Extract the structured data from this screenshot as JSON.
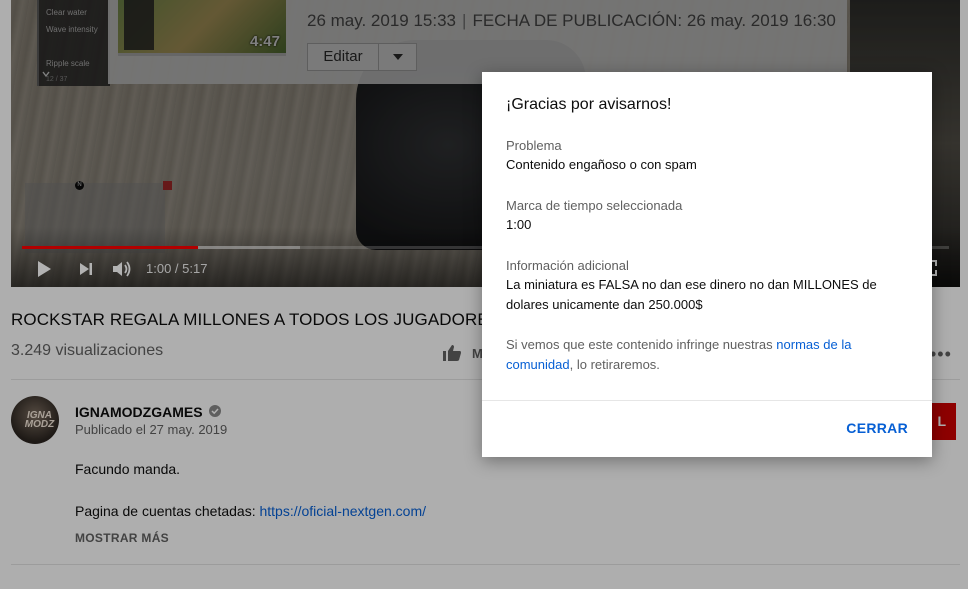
{
  "video": {
    "overlay_menu": [
      "Clear water",
      "Wave intensity",
      "Ripple scale"
    ],
    "overlay_counter": "12 / 37",
    "studio": {
      "thumb_duration": "4:47",
      "date_created": "26 may. 2019 15:33",
      "separator": "|",
      "published_label": "FECHA DE PUBLICACIÓN: 26 may. 2019 16:30",
      "edit_label": "Editar"
    },
    "minimap_marker": "N",
    "progress": {
      "played_fraction": 0.19,
      "buffered_fraction": 0.3
    },
    "time": "1:00 / 5:17"
  },
  "info": {
    "title": "ROCKSTAR REGALA MILLONES A TODOS LOS JUGADORES",
    "views": "3.249 visualizaciones",
    "like_label": "M",
    "more": "•••"
  },
  "channel": {
    "avatar_text": "IGNA MODZ",
    "name": "IGNAMODZGAMES",
    "published": "Publicado el 27 may. 2019",
    "subscribe_label": "L",
    "description_line1": "Facundo manda.",
    "description_prefix": "Pagina de cuentas chetadas: ",
    "description_link": "https://oficial-nextgen.com/",
    "show_more": "MOSTRAR MÁS"
  },
  "dialog": {
    "title": "¡Gracias por avisarnos!",
    "problem_label": "Problema",
    "problem_value": "Contenido engañoso o con spam",
    "timestamp_label": "Marca de tiempo seleccionada",
    "timestamp_value": "1:00",
    "info_label": "Información adicional",
    "info_value": "La miniatura es FALSA no dan ese dinero no dan MILLONES de dolares unicamente dan 250.000$",
    "note_prefix": "Si vemos que este contenido infringe nuestras ",
    "note_link": "normas de la comunidad",
    "note_suffix": ", lo retiraremos.",
    "close_label": "CERRAR"
  },
  "colors": {
    "accent_blue": "#065fd4",
    "progress_red": "#ff0000",
    "subscribe_red": "#cc0000"
  }
}
